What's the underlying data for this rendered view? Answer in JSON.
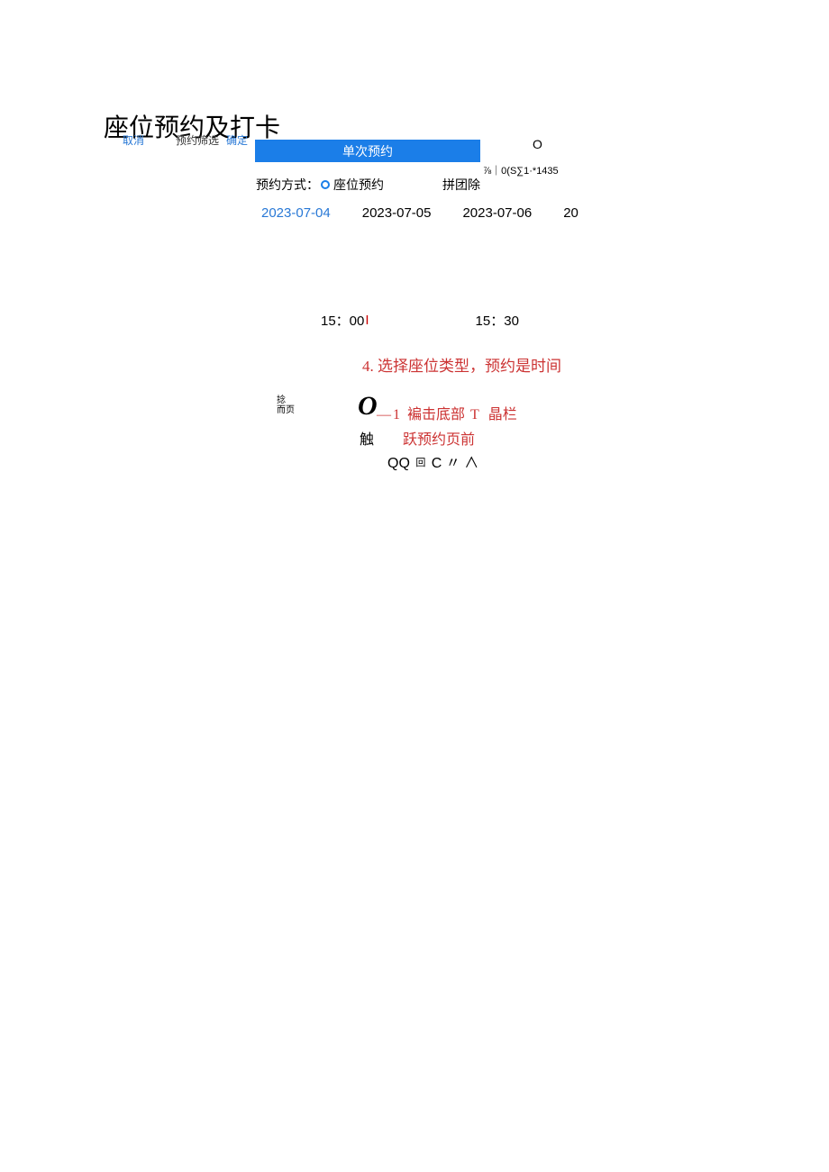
{
  "page": {
    "title": "座位预约及打卡"
  },
  "modal": {
    "cancel": "取消",
    "title": "预约筛选",
    "confirm": "确定"
  },
  "tab": {
    "active": "单次预约"
  },
  "status": {
    "circle": "O",
    "text": "⅞｜0(S∑1·*1435"
  },
  "mode": {
    "label": "预约方式：",
    "opt1": "座位预约",
    "opt2": "拼团除"
  },
  "dates": {
    "d1": "2023-07-04",
    "d2": "2023-07-05",
    "d3": "2023-07-06",
    "d4": "20"
  },
  "times": {
    "t1": "15：00",
    "cursor": "I",
    "t2": "15：30"
  },
  "annotations": {
    "a4": "4. 选择座位类型，预约是时间",
    "navTop": "捻",
    "navBottom": "而页",
    "zero": "O",
    "dash": "—",
    "num1": "1",
    "line1_a": "褊击底部",
    "line1_t": "T",
    "line1_b": "晶栏",
    "line2_a": "触",
    "line2_b": "跃预约页前",
    "symbols_qq": "QQ",
    "symbols_sq": "回",
    "symbols_rest": "C 〃 ∧"
  }
}
